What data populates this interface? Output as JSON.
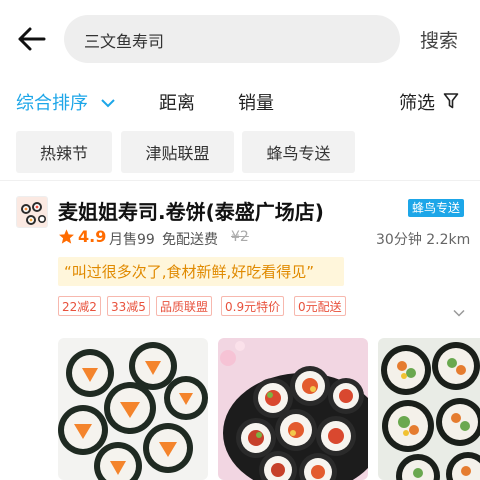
{
  "header": {
    "search_query": "三文鱼寿司",
    "search_button": "搜索"
  },
  "sort_bar": {
    "comprehensive": "综合排序",
    "distance": "距离",
    "sales": "销量",
    "filter": "筛选"
  },
  "chips": [
    "热辣节",
    "津贴联盟",
    "蜂鸟专送"
  ],
  "store": {
    "name": "麦姐姐寿司.卷饼(泰盛广场店)",
    "delivery_badge": "蜂鸟专送",
    "rating": "4.9",
    "monthly_sales": "月售99",
    "free_delivery": "免配送费",
    "original_fee": "¥2",
    "eta_distance": "30分钟 2.2km",
    "review_quote": "“叫过很多次了,食材新鲜,好吃看得见”",
    "promos": [
      "22减2",
      "33减5",
      "品质联盟",
      "0.9元特价",
      "0元配送"
    ]
  },
  "colors": {
    "accent": "#1da6e8",
    "rating": "#ff6b00",
    "promo": "#e8523d"
  },
  "icons": [
    "back-arrow-icon",
    "chevron-down-icon",
    "filter-funnel-icon",
    "star-icon",
    "expand-chevron-icon"
  ]
}
